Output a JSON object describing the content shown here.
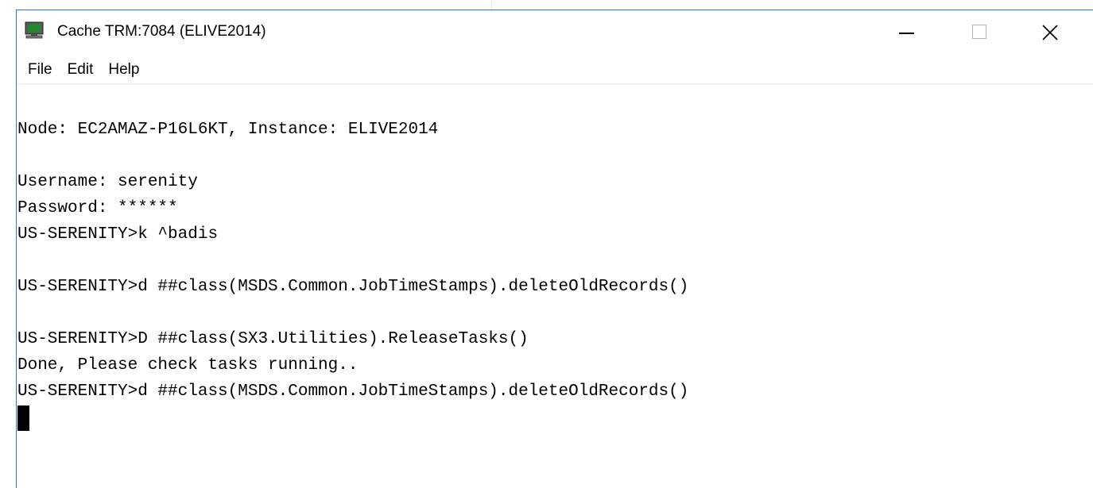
{
  "window": {
    "title": "Cache TRM:7084 (ELIVE2014)",
    "app_icon": "terminal-monitor-icon",
    "controls": {
      "minimize_icon": "minimize-icon",
      "maximize_icon": "maximize-icon",
      "close_icon": "close-icon"
    },
    "accent_color": "#2b79d0"
  },
  "menu": {
    "items": [
      {
        "label": "File"
      },
      {
        "label": "Edit"
      },
      {
        "label": "Help"
      }
    ]
  },
  "terminal": {
    "lines": [
      "Node: EC2AMAZ-P16L6KT, Instance: ELIVE2014",
      "",
      "Username: serenity",
      "Password: ******",
      "US-SERENITY>k ^badis",
      "",
      "US-SERENITY>d ##class(MSDS.Common.JobTimeStamps).deleteOldRecords()",
      "",
      "US-SERENITY>D ##class(SX3.Utilities).ReleaseTasks()",
      "Done, Please check tasks running..",
      "US-SERENITY>d ##class(MSDS.Common.JobTimeStamps).deleteOldRecords()"
    ],
    "cursor": "block-cursor"
  }
}
